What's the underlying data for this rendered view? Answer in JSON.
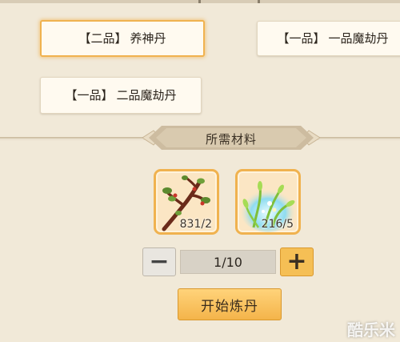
{
  "recipes": [
    {
      "grade": "【二品】",
      "name": "养神丹",
      "selected": true
    },
    {
      "grade": "【一品】",
      "name": "一品魔劫丹",
      "selected": false
    },
    {
      "grade": "【一品】",
      "name": "二品魔劫丹",
      "selected": false
    }
  ],
  "materials_section": {
    "title": "所需材料"
  },
  "materials": [
    {
      "icon": "branch-herb-icon",
      "count": "831/2"
    },
    {
      "icon": "glowing-grass-herb-icon",
      "count": "216/5"
    }
  ],
  "quantity": {
    "minus_label": "−",
    "value": "1/10",
    "plus_label": "+"
  },
  "start_button": {
    "label": "开始炼丹"
  },
  "watermark": "酷乐米",
  "colors": {
    "background": "#f1e9d8",
    "accent": "#f0b24f",
    "button": "#f5bf55"
  }
}
